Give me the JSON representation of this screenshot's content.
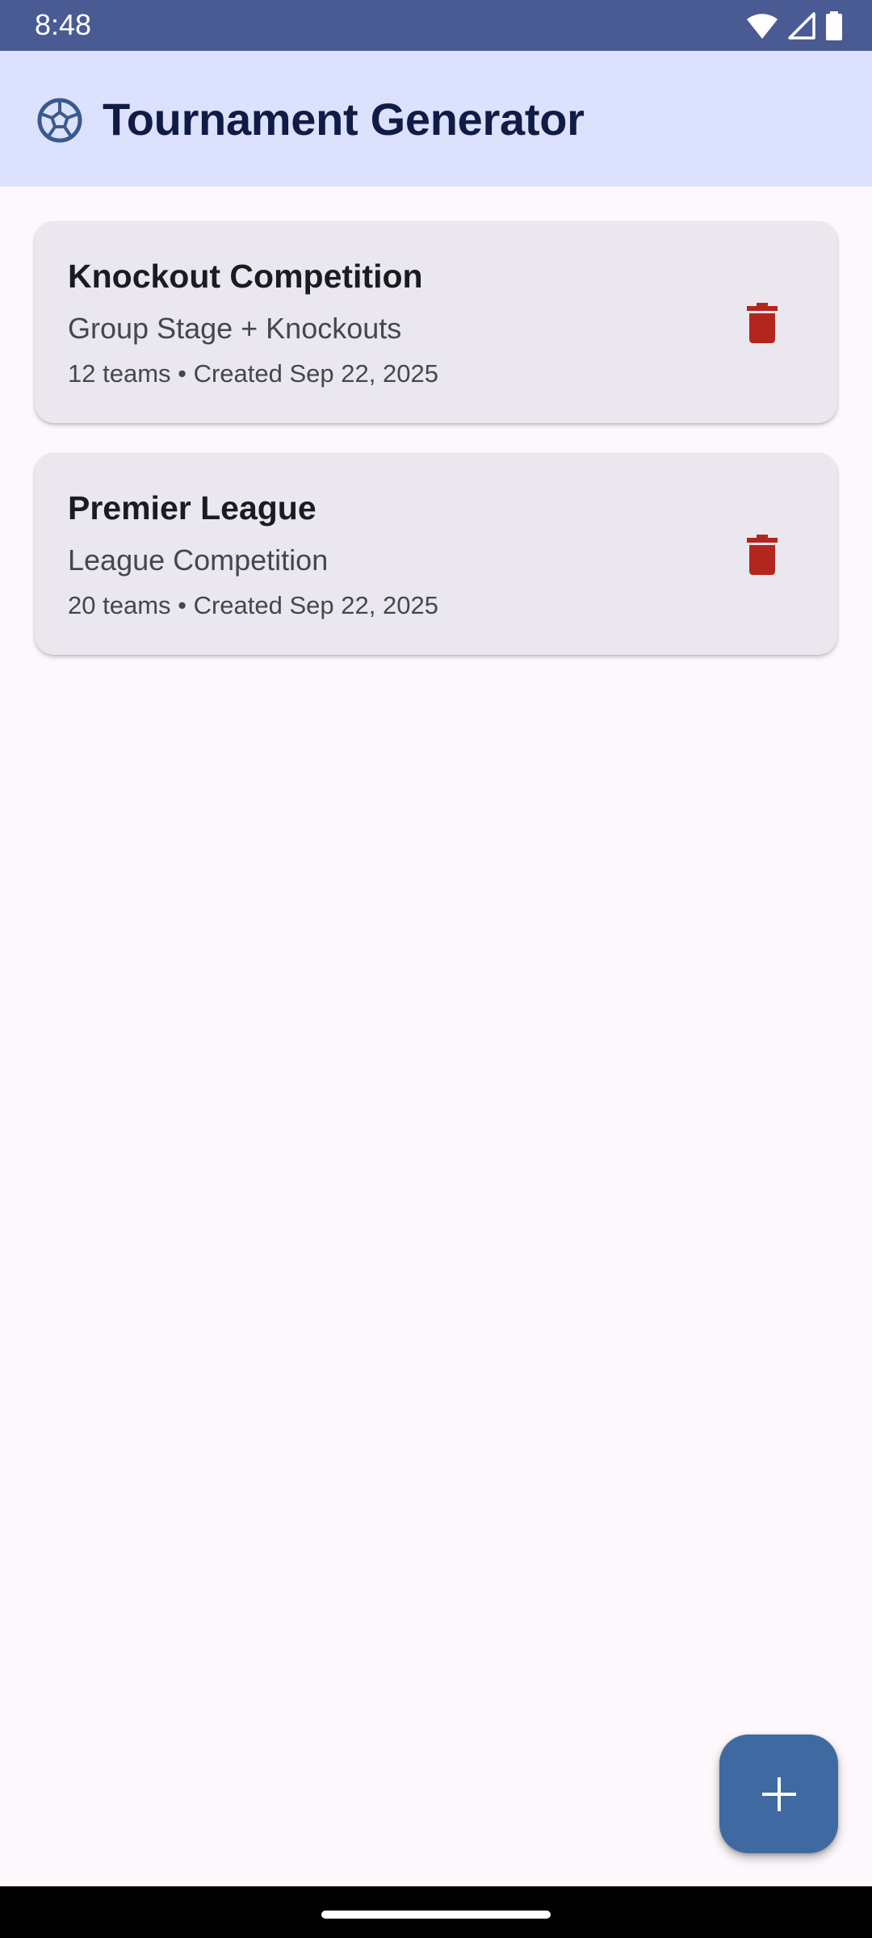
{
  "status_bar": {
    "time": "8:48",
    "icons": [
      "wifi-icon",
      "signal-icon",
      "battery-icon"
    ]
  },
  "app_bar": {
    "title": "Tournament Generator",
    "logo_icon": "soccer-ball-icon"
  },
  "tournaments": [
    {
      "name": "Knockout Competition",
      "format": "Group Stage + Knockouts",
      "meta": "12 teams • Created Sep 22, 2025"
    },
    {
      "name": "Premier League",
      "format": "League Competition",
      "meta": "20 teams • Created Sep 22, 2025"
    }
  ],
  "fab": {
    "icon": "plus-icon"
  },
  "colors": {
    "status_bar": "#4a5b94",
    "app_bar": "#dce1fd",
    "title_text": "#101c46",
    "card_bg": "#ebe7ef",
    "delete_icon": "#b3261e",
    "fab": "#3e6aa1",
    "background": "#fcf8fc"
  }
}
